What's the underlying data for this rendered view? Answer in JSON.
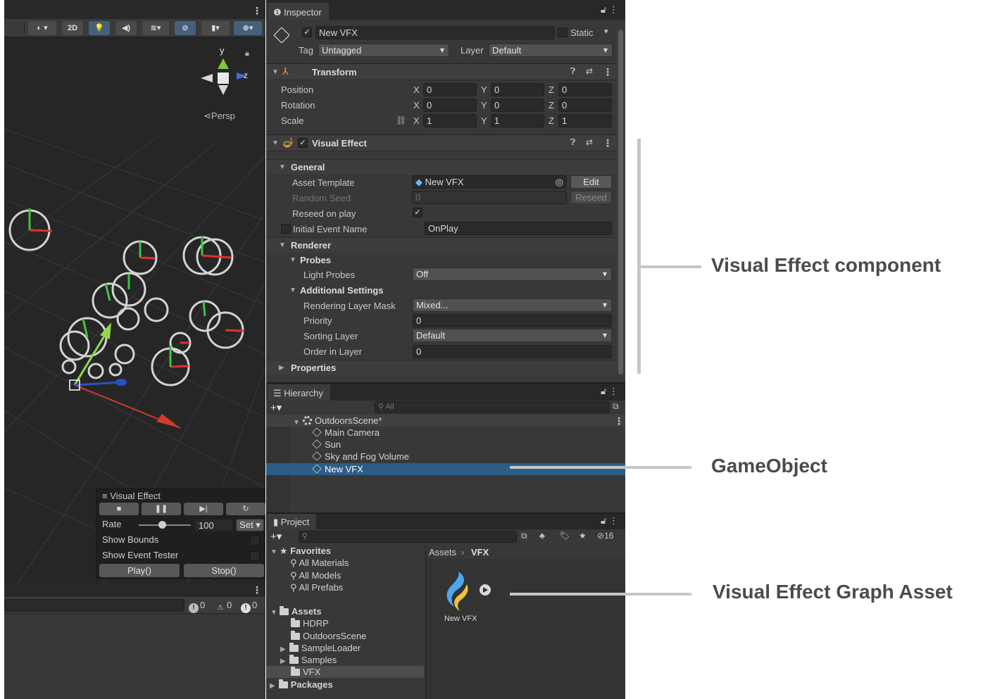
{
  "scene": {
    "toolbar": {
      "mode_2d": "2D"
    },
    "gizmo": {
      "y": "y",
      "z": "z",
      "persp": "Persp"
    },
    "vfx_overlay": {
      "title": "Visual Effect",
      "rate_label": "Rate",
      "rate_value": "100",
      "rate_fraction": 0.45,
      "set_label": "Set",
      "show_bounds": "Show Bounds",
      "show_event_tester": "Show Event Tester",
      "play_button": "Play()",
      "stop_button": "Stop()"
    },
    "console": {
      "info_count": "0",
      "warn_count": "0",
      "error_count": "0"
    }
  },
  "inspector": {
    "tab": "Inspector",
    "object_name": "New VFX",
    "static_label": "Static",
    "tag_label": "Tag",
    "tag_value": "Untagged",
    "layer_label": "Layer",
    "layer_value": "Default",
    "transform": {
      "title": "Transform",
      "position_label": "Position",
      "rotation_label": "Rotation",
      "scale_label": "Scale",
      "axes": [
        "X",
        "Y",
        "Z"
      ],
      "position": [
        "0",
        "0",
        "0"
      ],
      "rotation": [
        "0",
        "0",
        "0"
      ],
      "scale": [
        "1",
        "1",
        "1"
      ]
    },
    "visual_effect": {
      "title": "Visual Effect",
      "general": "General",
      "asset_template_label": "Asset Template",
      "asset_template_value": "New VFX",
      "edit_button": "Edit",
      "random_seed_label": "Random Seed",
      "random_seed_value": "0",
      "reseed_button": "Reseed",
      "reseed_on_play_label": "Reseed on play",
      "initial_event_label": "Initial Event Name",
      "initial_event_value": "OnPlay",
      "renderer": "Renderer",
      "probes": "Probes",
      "light_probes_label": "Light Probes",
      "light_probes_value": "Off",
      "additional_settings": "Additional Settings",
      "rendering_layer_mask_label": "Rendering Layer Mask",
      "rendering_layer_mask_value": "Mixed...",
      "priority_label": "Priority",
      "priority_value": "0",
      "sorting_layer_label": "Sorting Layer",
      "sorting_layer_value": "Default",
      "order_in_layer_label": "Order in Layer",
      "order_in_layer_value": "0",
      "properties": "Properties"
    }
  },
  "hierarchy": {
    "tab": "Hierarchy",
    "search_placeholder": "All",
    "scene_name": "OutdoorsScene*",
    "items": [
      "Main Camera",
      "Sun",
      "Sky and Fog Volume",
      "New VFX"
    ]
  },
  "project": {
    "tab": "Project",
    "hidden_count": "16",
    "favorites": "Favorites",
    "favorites_items": [
      "All Materials",
      "All Models",
      "All Prefabs"
    ],
    "assets": "Assets",
    "asset_folders": [
      "HDRP",
      "OutdoorsScene",
      "SampleLoader",
      "Samples",
      "VFX"
    ],
    "packages": "Packages",
    "breadcrumb": [
      "Assets",
      "VFX"
    ],
    "asset_item": "New VFX"
  },
  "annotations": {
    "component": "Visual Effect component",
    "gameobject": "GameObject",
    "graph_asset": "Visual Effect Graph Asset"
  },
  "colors": {
    "panel_bg": "#383838",
    "selection": "#2c5d87",
    "annotation_text": "#4b4b4b",
    "annotation_line": "#c7c7c7"
  }
}
